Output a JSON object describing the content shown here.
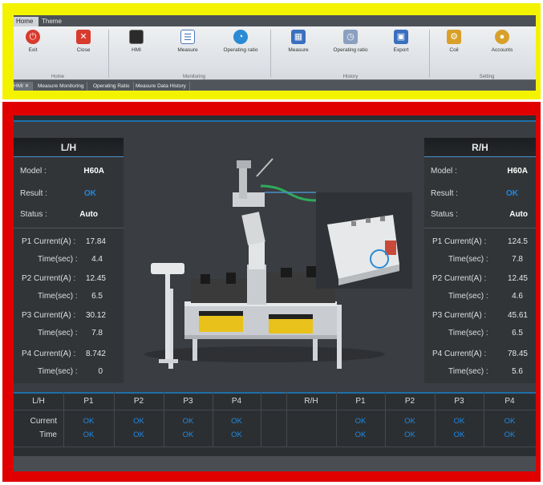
{
  "ribbon": {
    "tabs": [
      "Home",
      "Theme"
    ],
    "buttons": [
      {
        "label": "Exit",
        "icon": "power-icon",
        "color": "#d83a2e"
      },
      {
        "label": "Close",
        "icon": "close-icon",
        "color": "#d83a2e"
      },
      {
        "label": "HMI",
        "icon": "monitor-icon",
        "color": "#2b2b2b"
      },
      {
        "label": "Measure",
        "icon": "list-icon",
        "color": "#4a78b4"
      },
      {
        "label": "Operating ratio",
        "icon": "gauge-icon",
        "color": "#2a8ad4"
      },
      {
        "label": "Measure",
        "icon": "grid-icon",
        "color": "#3a6fbf"
      },
      {
        "label": "Operating ratio",
        "icon": "gauge-history-icon",
        "color": "#3a6fbf"
      },
      {
        "label": "Export",
        "icon": "save-icon",
        "color": "#3a6fbf"
      },
      {
        "label": "Coil",
        "icon": "coil-icon",
        "color": "#d8a028"
      },
      {
        "label": "Accounts",
        "icon": "user-icon",
        "color": "#d8a028"
      }
    ],
    "groups": [
      "Home",
      "Monitoring",
      "History",
      "Setting"
    ]
  },
  "doc_tabs": [
    "HMI",
    "Measure Monitoring",
    "Operating Ratio",
    "Measure Data History"
  ],
  "left": {
    "header": "L/H",
    "model_label": "Model :",
    "model": "H60A",
    "result_label": "Result :",
    "result": "OK",
    "status_label": "Status :",
    "status": "Auto",
    "p1_label": "P1 Current(A) :",
    "p1": "17.84",
    "p1_time_label": "Time(sec) :",
    "p1_time": "4.4",
    "p2_label": "P2 Current(A) :",
    "p2": "12.45",
    "p2_time_label": "Time(sec) :",
    "p2_time": "6.5",
    "p3_label": "P3 Current(A) :",
    "p3": "30.12",
    "p3_time_label": "Time(sec) :",
    "p3_time": "7.8",
    "p4_label": "P4 Current(A) :",
    "p4": "8.742",
    "p4_time_label": "Time(sec) :",
    "p4_time": "0"
  },
  "right": {
    "header": "R/H",
    "model_label": "Model :",
    "model": "H60A",
    "result_label": "Result :",
    "result": "OK",
    "status_label": "Status :",
    "status": "Auto",
    "p1_label": "P1 Current(A) :",
    "p1": "124.5",
    "p1_time_label": "Time(sec) :",
    "p1_time": "7.8",
    "p2_label": "P2 Current(A) :",
    "p2": "12.45",
    "p2_time_label": "Time(sec) :",
    "p2_time": "4.6",
    "p3_label": "P3 Current(A) :",
    "p3": "45.61",
    "p3_time_label": "Time(sec) :",
    "p3_time": "6.5",
    "p4_label": "P4 Current(A) :",
    "p4": "78.45",
    "p4_time_label": "Time(sec) :",
    "p4_time": "5.6"
  },
  "table": {
    "lh": "L/H",
    "rh": "R/H",
    "cols": [
      "P1",
      "P2",
      "P3",
      "P4"
    ],
    "row_current": "Current",
    "row_time": "Time",
    "lh_current": [
      "OK",
      "OK",
      "OK",
      "OK"
    ],
    "lh_time": [
      "OK",
      "OK",
      "OK",
      "OK"
    ],
    "rh_current": [
      "OK",
      "OK",
      "OK",
      "OK"
    ],
    "rh_time": [
      "OK",
      "OK",
      "OK",
      "OK"
    ]
  },
  "colors": {
    "ok": "#1e8ae6",
    "accent": "#1e6fa8",
    "frame_top": "#f3f300",
    "frame_bottom": "#e00000"
  }
}
